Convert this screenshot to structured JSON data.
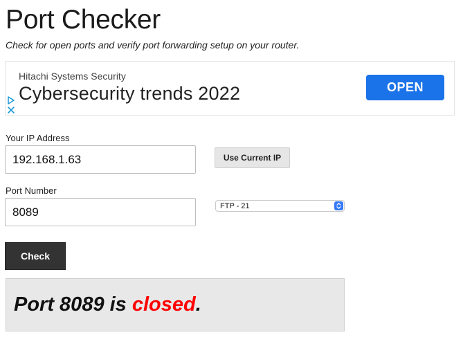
{
  "header": {
    "title": "Port Checker",
    "subtitle": "Check for open ports and verify port forwarding setup on your router."
  },
  "ad": {
    "brand": "Hitachi Systems Security",
    "headline": "Cybersecurity trends 2022",
    "cta_label": "OPEN",
    "cta_color": "#1a73e8"
  },
  "form": {
    "ip_label": "Your IP Address",
    "ip_value": "192.168.1.63",
    "use_current_ip_label": "Use Current IP",
    "port_label": "Port Number",
    "port_value": "8089",
    "service_selected": "FTP - 21",
    "check_label": "Check"
  },
  "result": {
    "prefix": "Port 8089 is ",
    "status": "closed",
    "suffix": ".",
    "status_color": "#ff0000"
  }
}
